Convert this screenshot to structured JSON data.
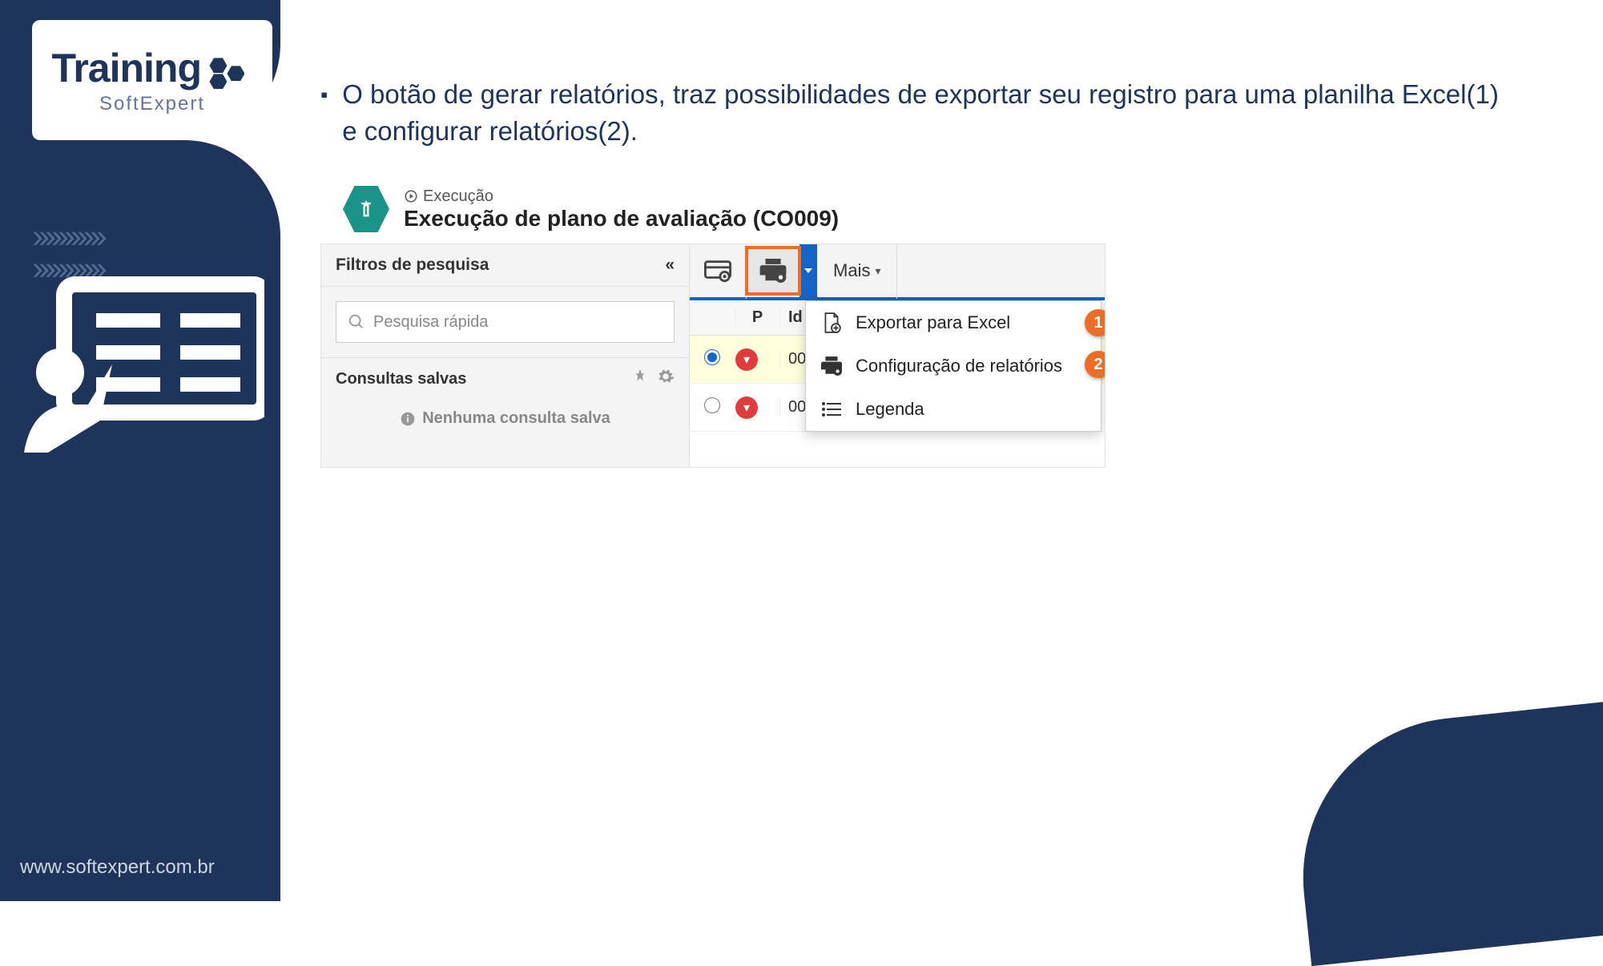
{
  "brand": {
    "logo_top": "Training",
    "logo_sub": "SoftExpert"
  },
  "footer_url": "www.softexpert.com.br",
  "bullet_text": "O botão de gerar relatórios, traz possibilidades de exportar seu registro para uma planilha Excel(1) e configurar  relatórios(2).",
  "screenshot": {
    "breadcrumb": "Execução",
    "title": "Execução de plano de avaliação (CO009)",
    "filters": {
      "heading": "Filtros de pesquisa",
      "search_placeholder": "Pesquisa rápida",
      "saved_heading": "Consultas salvas",
      "no_saved": "Nenhuma consulta salva"
    },
    "toolbar": {
      "more": "Mais"
    },
    "columns": {
      "p": "P",
      "id": "Id"
    },
    "rows": [
      {
        "selected": true,
        "id_fragment": "00"
      },
      {
        "selected": false,
        "id_fragment": "00"
      }
    ],
    "dropdown": {
      "items": [
        {
          "label": "Exportar para Excel",
          "badge": "1"
        },
        {
          "label": "Configuração de relatórios",
          "badge": "2"
        },
        {
          "label": "Legenda"
        }
      ]
    }
  }
}
